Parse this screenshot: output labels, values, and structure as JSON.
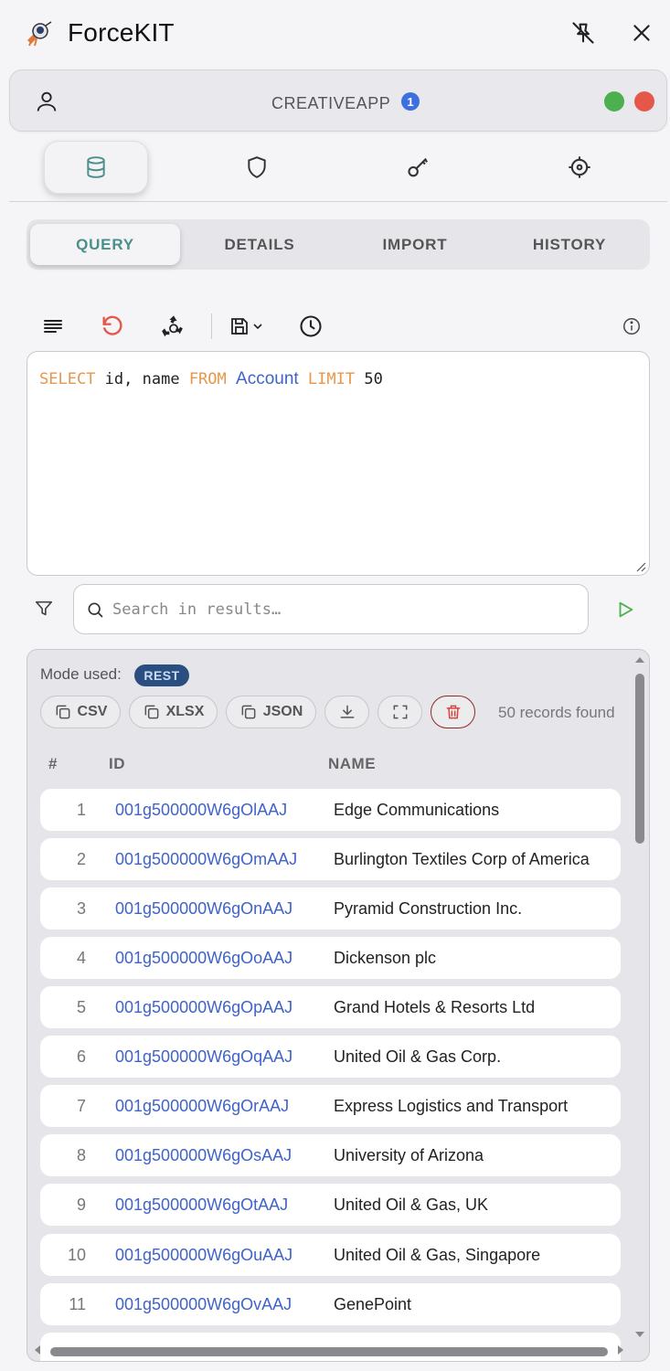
{
  "app": {
    "title": "ForceKIT"
  },
  "org": {
    "name": "CREATIVEAPP",
    "badge_count": "1"
  },
  "sub_tabs": [
    {
      "label": "QUERY"
    },
    {
      "label": "DETAILS"
    },
    {
      "label": "IMPORT"
    },
    {
      "label": "HISTORY"
    }
  ],
  "query": {
    "kw_select": "SELECT",
    "fields": "id, name",
    "kw_from": "FROM",
    "object": "Account",
    "kw_limit": "LIMIT",
    "limit_value": "50"
  },
  "search": {
    "placeholder": "Search in results…"
  },
  "results": {
    "mode_label": "Mode used:",
    "mode": "REST",
    "export_csv": "CSV",
    "export_xlsx": "XLSX",
    "export_json": "JSON",
    "records_found": "50 records found",
    "columns": {
      "num": "#",
      "id": "ID",
      "name": "NAME"
    },
    "rows": [
      {
        "num": "1",
        "id": "001g500000W6gOlAAJ",
        "name": "Edge Communications"
      },
      {
        "num": "2",
        "id": "001g500000W6gOmAAJ",
        "name": "Burlington Textiles Corp of America"
      },
      {
        "num": "3",
        "id": "001g500000W6gOnAAJ",
        "name": "Pyramid Construction Inc."
      },
      {
        "num": "4",
        "id": "001g500000W6gOoAAJ",
        "name": "Dickenson plc"
      },
      {
        "num": "5",
        "id": "001g500000W6gOpAAJ",
        "name": "Grand Hotels & Resorts Ltd"
      },
      {
        "num": "6",
        "id": "001g500000W6gOqAAJ",
        "name": "United Oil & Gas Corp."
      },
      {
        "num": "7",
        "id": "001g500000W6gOrAAJ",
        "name": "Express Logistics and Transport"
      },
      {
        "num": "8",
        "id": "001g500000W6gOsAAJ",
        "name": "University of Arizona"
      },
      {
        "num": "9",
        "id": "001g500000W6gOtAAJ",
        "name": "United Oil & Gas, UK"
      },
      {
        "num": "10",
        "id": "001g500000W6gOuAAJ",
        "name": "United Oil & Gas, Singapore"
      },
      {
        "num": "11",
        "id": "001g500000W6gOvAAJ",
        "name": "GenePoint"
      }
    ]
  },
  "colors": {
    "accent": "#4a8f8a",
    "link": "#3f63c8",
    "keyword": "#e8964b",
    "status_green": "#4caf50",
    "status_red": "#e5574b",
    "badge_blue": "#3d6fe0"
  }
}
